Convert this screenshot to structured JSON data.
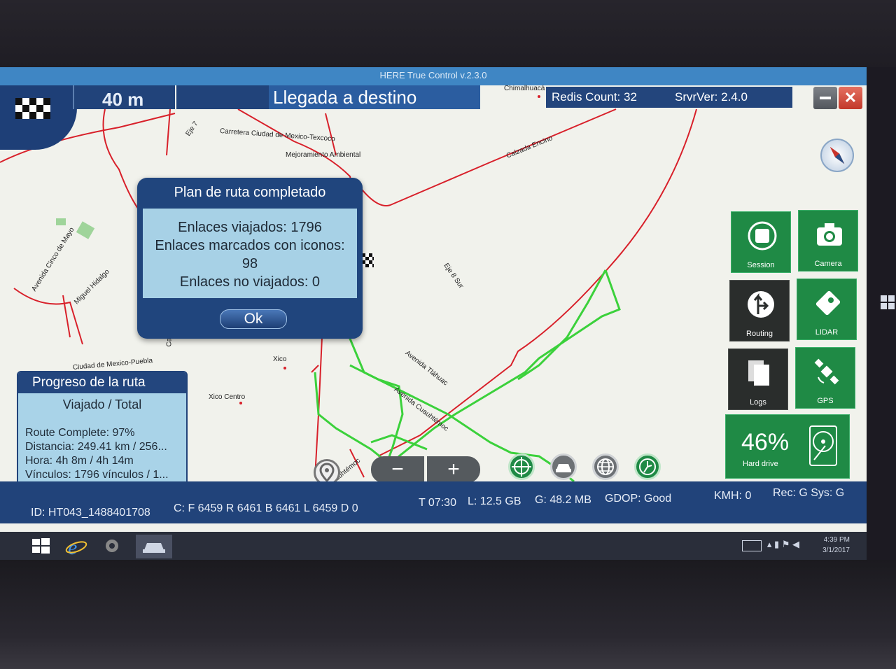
{
  "window": {
    "title": "HERE True Control v.2.3.0"
  },
  "nav": {
    "distance": "40 m",
    "instruction": "Llegada a destino",
    "redis": "Redis Count: 32",
    "server_version": "SrvrVer: 2.4.0"
  },
  "map_labels": {
    "chimalhuacan": "Chimalhuacá",
    "eje7": "Eje 7",
    "carretera": "Carretera Ciudad de Mexico-Texcoco",
    "mejoramiento": "Mejoramiento Ambiental",
    "calzada": "Calzada Encino",
    "cinco_mayo": "Avenida Cinco de Mayo",
    "miguel_hidalgo": "Miguel Hidalgo",
    "eje8": "Eje 8 Sur",
    "tlahuac": "Avenida Tláhuac",
    "cuauhtemoc": "Avenida Cuauhtémoc",
    "cuauhtemoc2": "Cuauhtémoc",
    "ciudad_puebla": "Ciudad de Mexico-Puebla",
    "xico": "Xico",
    "xico_centro": "Xico Centro",
    "cal": "Cal"
  },
  "dialog": {
    "title": "Plan de ruta completado",
    "line1": "Enlaces viajados: 1796",
    "line2": "Enlaces marcados con iconos:",
    "line3": "98",
    "line4": "Enlaces no viajados: 0",
    "ok": "Ok"
  },
  "tiles": {
    "session": "Session",
    "camera": "Camera",
    "routing": "Routing",
    "lidar": "LIDAR",
    "logs": "Logs",
    "gps": "GPS",
    "hdd_percent": "46%",
    "hdd_label": "Hard drive",
    "hdd_fill": 0.46
  },
  "progress": {
    "title": "Progreso de la ruta",
    "subtitle": "Viajado / Total",
    "complete": "Route Complete: 97%",
    "distance": "Distancia: 249.41 km / 256...",
    "time": "Hora: 4h 8m / 4h 14m",
    "links": "Vínculos: 1796 vínculos / 1..."
  },
  "status": {
    "id": "ID: HT043_1488401708",
    "counts": "C: F 6459 R 6461 B 6461 L 6459 D 0",
    "time": "T 07:30",
    "lidar": "L:  12.5 GB",
    "gps_size": "G:  48.2 MB",
    "gdop": "GDOP: Good",
    "kmh": "KMH: 0",
    "rec": "Rec: G  Sys: G"
  },
  "tray": {
    "time": "4:39 PM",
    "date": "3/1/2017"
  },
  "colors": {
    "panel_blue": "#21437a",
    "tile_green": "#1f8a45",
    "track_green": "#3bd13b",
    "road_red": "#d8202a"
  }
}
